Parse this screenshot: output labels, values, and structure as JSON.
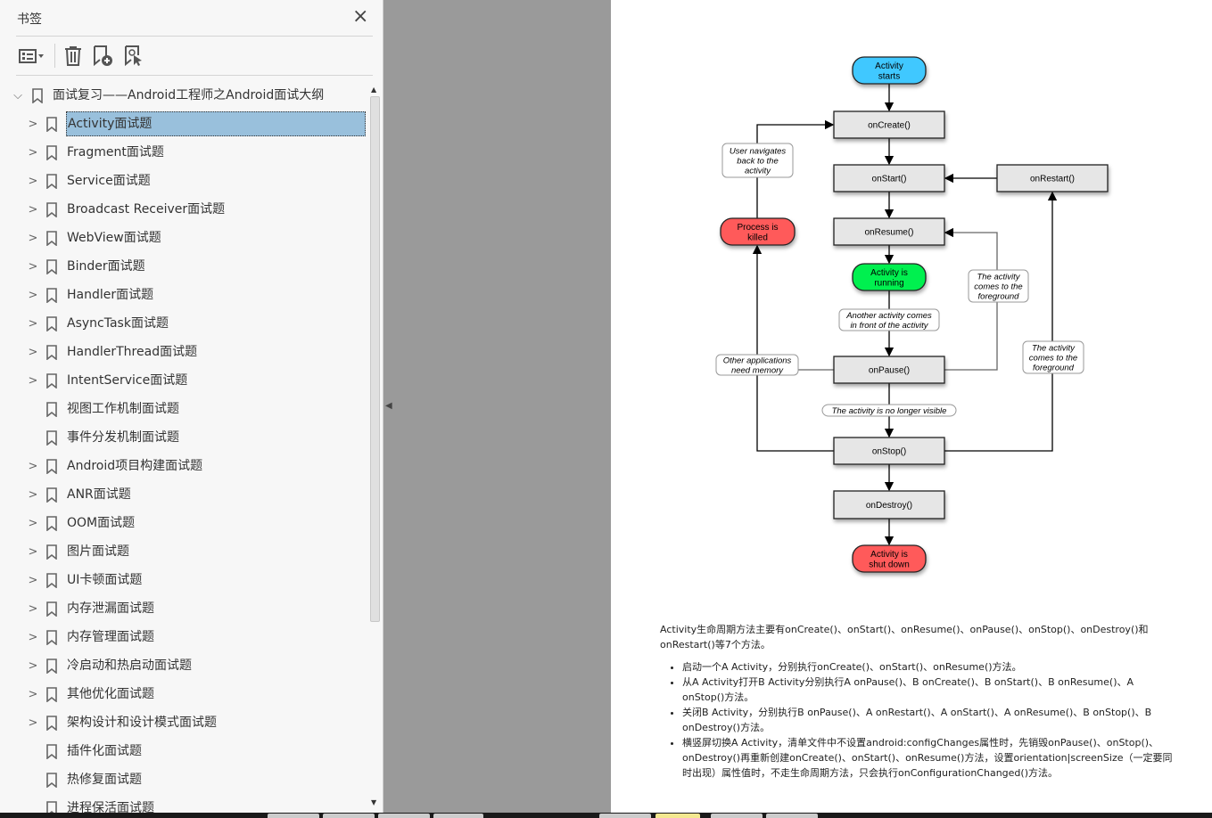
{
  "panel": {
    "title": "书签",
    "close": "×"
  },
  "toolbar": {
    "icons": [
      "bookmark-options-icon",
      "delete-bookmark-icon",
      "new-bookmark-icon",
      "find-current-bookmark-icon"
    ]
  },
  "tree": {
    "root": "面试复习——Android工程师之Android面试大纲",
    "items": [
      {
        "label": "Activity面试题",
        "expandable": true,
        "selected": true
      },
      {
        "label": "Fragment面试题",
        "expandable": true
      },
      {
        "label": "Service面试题",
        "expandable": true
      },
      {
        "label": "Broadcast Receiver面试题",
        "expandable": true
      },
      {
        "label": "WebView面试题",
        "expandable": true
      },
      {
        "label": "Binder面试题",
        "expandable": true
      },
      {
        "label": "Handler面试题",
        "expandable": true
      },
      {
        "label": "AsyncTask面试题",
        "expandable": true
      },
      {
        "label": "HandlerThread面试题",
        "expandable": true
      },
      {
        "label": "IntentService面试题",
        "expandable": true
      },
      {
        "label": "视图工作机制面试题",
        "expandable": false
      },
      {
        "label": "事件分发机制面试题",
        "expandable": false
      },
      {
        "label": "Android项目构建面试题",
        "expandable": true
      },
      {
        "label": "ANR面试题",
        "expandable": true
      },
      {
        "label": "OOM面试题",
        "expandable": true
      },
      {
        "label": "图片面试题",
        "expandable": true
      },
      {
        "label": "UI卡顿面试题",
        "expandable": true
      },
      {
        "label": "内存泄漏面试题",
        "expandable": true
      },
      {
        "label": "内存管理面试题",
        "expandable": true
      },
      {
        "label": "冷启动和热启动面试题",
        "expandable": true
      },
      {
        "label": "其他优化面试题",
        "expandable": true
      },
      {
        "label": "架构设计和设计模式面试题",
        "expandable": true
      },
      {
        "label": "插件化面试题",
        "expandable": false
      },
      {
        "label": "热修复面试题",
        "expandable": false
      },
      {
        "label": "进程保活面试题",
        "expandable": false
      }
    ]
  },
  "diagram": {
    "nodes": {
      "start": [
        "Activity",
        "starts"
      ],
      "onCreate": "onCreate()",
      "onStart": "onStart()",
      "onRestart": "onRestart()",
      "onResume": "onResume()",
      "running": [
        "Activity is",
        "running"
      ],
      "killed": [
        "Process is",
        "killed"
      ],
      "onPause": "onPause()",
      "onStop": "onStop()",
      "onDestroy": "onDestroy()",
      "shutdown": [
        "Activity is",
        "shut down"
      ]
    },
    "labels": {
      "navigate": [
        "User navigates",
        "back to the",
        "activity"
      ],
      "another": [
        "Another activity comes",
        "in front of the activity"
      ],
      "foreground1": [
        "The activity",
        "comes to the",
        "foreground"
      ],
      "foreground2": [
        "The activity",
        "comes to the",
        "foreground"
      ],
      "memory": [
        "Other applications",
        "need memory"
      ],
      "invisible": "The activity is no longer visible"
    },
    "colors": {
      "start": "#40c8ff",
      "running": "#00f050",
      "end": "#ff5a5a",
      "box": "#e6e6e6"
    }
  },
  "prose": {
    "intro": "Activity生命周期方法主要有onCreate()、onStart()、onResume()、onPause()、onStop()、onDestroy()和onRestart()等7个方法。",
    "bullets": [
      "启动一个A Activity，分别执行onCreate()、onStart()、onResume()方法。",
      "从A Activity打开B Activity分别执行A onPause()、B onCreate()、B onStart()、B onResume()、A onStop()方法。",
      "关闭B Activity，分别执行B onPause()、A onRestart()、A onStart()、A onResume()、B onStop()、B onDestroy()方法。",
      "横竖屏切换A Activity，清单文件中不设置android:configChanges属性时，先销毁onPause()、onStop()、onDestroy()再重新创建onCreate()、onStart()、onResume()方法，设置orientation|screenSize（一定要同时出现）属性值时，不走生命周期方法，只会执行onConfigurationChanged()方法。"
    ]
  }
}
